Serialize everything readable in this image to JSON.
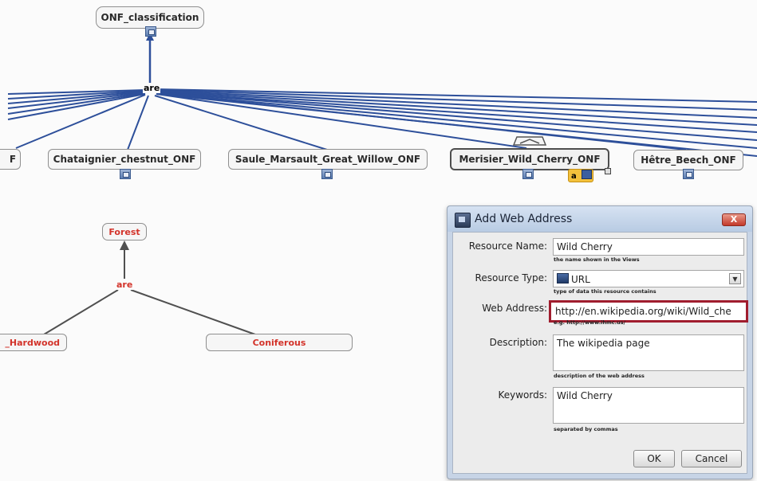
{
  "graph": {
    "root": "ONF_classification",
    "link_label": "are",
    "nodes": [
      "F",
      "Chataignier_chestnut_ONF",
      "Saule_Marsault_Great_Willow_ONF",
      "Merisier_Wild_Cherry_ONF",
      "Hêtre_Beech_ONF"
    ],
    "selected_node_badge": "a"
  },
  "subgraph": {
    "parent": "Forest",
    "link_label": "are",
    "children": [
      "_Hardwood",
      "Coniferous"
    ]
  },
  "dialog": {
    "title": "Add Web Address",
    "close_label": "X",
    "fields": {
      "resource_name": {
        "label": "Resource Name:",
        "value": "Wild Cherry",
        "hint": "the name shown in the Views"
      },
      "resource_type": {
        "label": "Resource Type:",
        "value": "URL",
        "hint": "type of data this resource contains"
      },
      "web_address": {
        "label": "Web Address:",
        "value": "http://en.wikipedia.org/wiki/Wild_che",
        "hint": "e.g. http://www.ihmc.us/"
      },
      "description": {
        "label": "Description:",
        "value": "The wikipedia page",
        "hint": "description of the web address"
      },
      "keywords": {
        "label": "Keywords:",
        "value": "Wild Cherry",
        "hint": "separated by commas"
      }
    },
    "ok_label": "OK",
    "cancel_label": "Cancel"
  },
  "colors": {
    "edge_blue": "#2d4f9a",
    "edge_gray": "#505050",
    "node_red_text": "#d3332a",
    "highlight_border": "#a01d2e",
    "dialog_frame": "#c7d4e6"
  }
}
